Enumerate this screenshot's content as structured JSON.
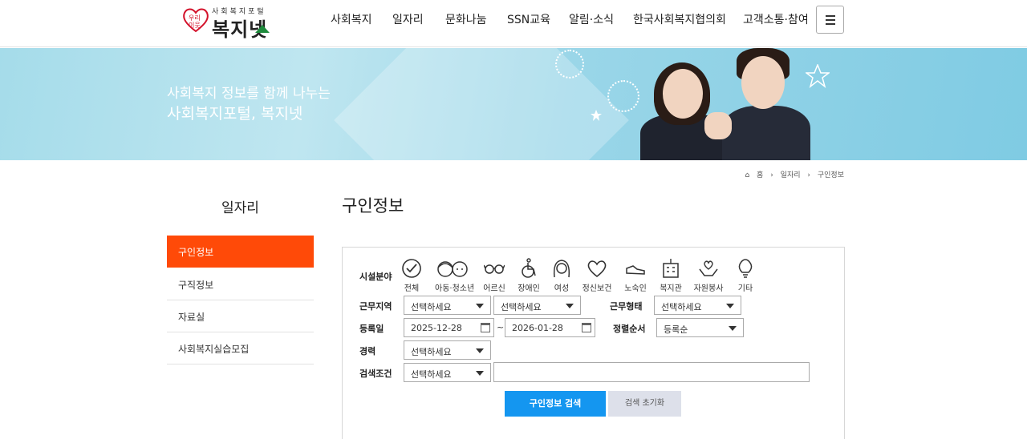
{
  "header": {
    "logo_mark": "우리이웃",
    "logo_sub": "사회복지포털",
    "logo_main": "복지넷",
    "nav": [
      "사회복지",
      "일자리",
      "문화나눔",
      "SSN교육",
      "알림·소식",
      "한국사회복지협의회",
      "고객소통·참여"
    ]
  },
  "banner": {
    "line1": "사회복지 정보를 함께 나누는",
    "line2": "사회복지포털, 복지넷"
  },
  "breadcrumb": [
    "홈",
    "일자리",
    "구인정보"
  ],
  "sidebar": {
    "title": "일자리",
    "items": [
      "구인정보",
      "구직정보",
      "자료실",
      "사회복지실습모집"
    ],
    "active_color": "#ff4a08"
  },
  "main": {
    "title": "구인정보",
    "form": {
      "facility_label": "시설분야",
      "categories": [
        "전체",
        "아동·청소년",
        "어르신",
        "장애인",
        "여성",
        "정신보건",
        "노숙인",
        "복지관",
        "자원봉사",
        "기타"
      ],
      "region_label": "근무지역",
      "region_select1": "선택하세요",
      "region_select2": "선택하세요",
      "worktype_label": "근무형태",
      "worktype_select": "선택하세요",
      "date_label": "등록일",
      "date_from": "2025-12-28",
      "date_tilde": "~",
      "date_to": "2026-01-28",
      "sort_label": "정렬순서",
      "sort_select": "등록순",
      "career_label": "경력",
      "career_select": "선택하세요",
      "condition_label": "검색조건",
      "condition_select": "선택하세요",
      "condition_value": "",
      "search_button": "구인정보 검색",
      "reset_button": "검색 초기화"
    },
    "primary_color": "#1496f0"
  }
}
